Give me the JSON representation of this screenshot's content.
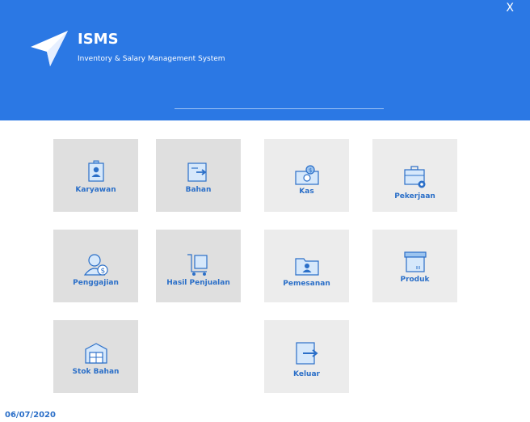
{
  "app": {
    "title": "ISMS",
    "subtitle": "Inventory & Salary Management System",
    "close_label": "X"
  },
  "tiles": [
    {
      "label": "Karyawan",
      "icon": "id-badge-icon"
    },
    {
      "label": "Bahan",
      "icon": "box-arrow-icon"
    },
    {
      "label": "Kas",
      "icon": "cash-icon"
    },
    {
      "label": "Pekerjaan",
      "icon": "briefcase-gear-icon"
    },
    {
      "label": "Penggajian",
      "icon": "salary-person-icon"
    },
    {
      "label": "Hasil Penjualan",
      "icon": "cart-box-icon"
    },
    {
      "label": "Pemesanan",
      "icon": "folder-user-icon"
    },
    {
      "label": "Produk",
      "icon": "product-box-icon"
    },
    {
      "label": "Stok Bahan",
      "icon": "warehouse-icon"
    },
    {
      "label": "Keluar",
      "icon": "exit-icon"
    }
  ],
  "status": {
    "date": "06/07/2020"
  },
  "colors": {
    "header": "#2b78e4",
    "accent": "#2b6fc8",
    "tile_dark": "#dfdfdf",
    "tile_light": "#ececec"
  }
}
